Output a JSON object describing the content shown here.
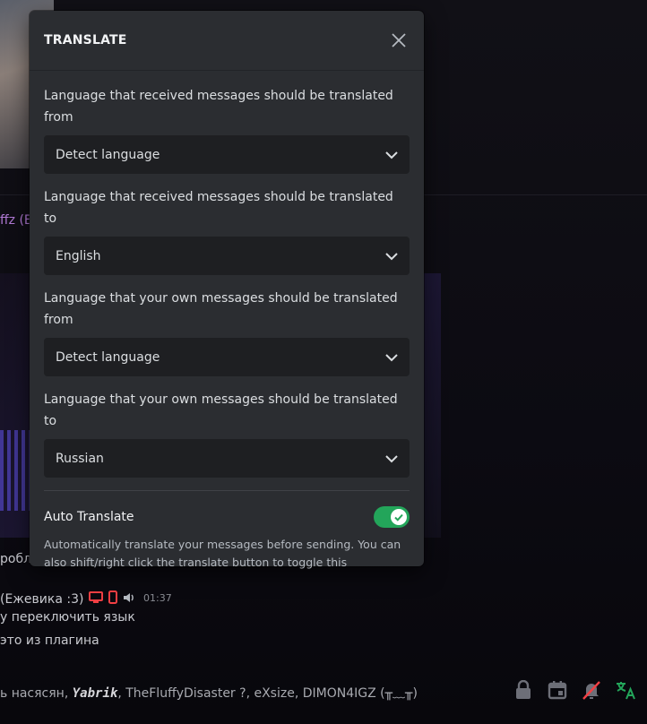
{
  "modal": {
    "title": "TRANSLATE",
    "fields": [
      {
        "label": "Language that received messages should be translated from",
        "value": "Detect language"
      },
      {
        "label": "Language that received messages should be translated to",
        "value": "English"
      },
      {
        "label": "Language that your own messages should be translated from",
        "value": "Detect language"
      },
      {
        "label": "Language that your own messages should be translated to",
        "value": "Russian"
      }
    ],
    "auto_translate": {
      "label": "Auto Translate",
      "enabled": true,
      "description": "Automatically translate your messages before sending. You can also shift/right click the translate button to toggle this"
    }
  },
  "background": {
    "name_fragment": "ffz (E",
    "msg_fragment": "робл",
    "author": "(Ежевика :3)",
    "time": "01:37",
    "line1": "у переключить язык",
    "line2": "это из плагина",
    "typing_prefix": "ь насясян, ",
    "typing_bold": "Yabrik",
    "typing_rest": ", TheFluffyDisaster ?, eXsize, DIMON4IGZ (╥﹏╥)"
  },
  "colors": {
    "modal_bg": "#2b2d31",
    "select_bg": "#1e1f22",
    "toggle_on": "#23a55a",
    "translate_icon": "#23a55a"
  }
}
